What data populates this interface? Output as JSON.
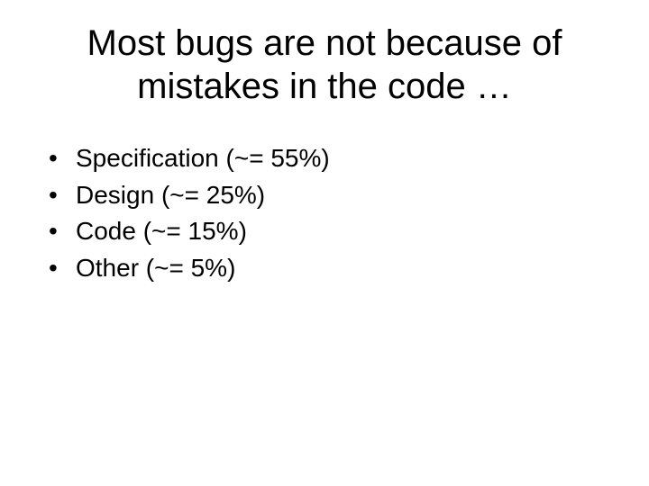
{
  "slide": {
    "title": "Most bugs are not because of mistakes in the code …",
    "bullets": [
      "Specification (~= 55%)",
      "Design (~= 25%)",
      "Code (~= 15%)",
      "Other (~= 5%)"
    ]
  },
  "chart_data": {
    "type": "table",
    "title": "Most bugs are not because of mistakes in the code …",
    "categories": [
      "Specification",
      "Design",
      "Code",
      "Other"
    ],
    "values": [
      55,
      25,
      15,
      5
    ],
    "unit": "percent",
    "approx": true
  }
}
